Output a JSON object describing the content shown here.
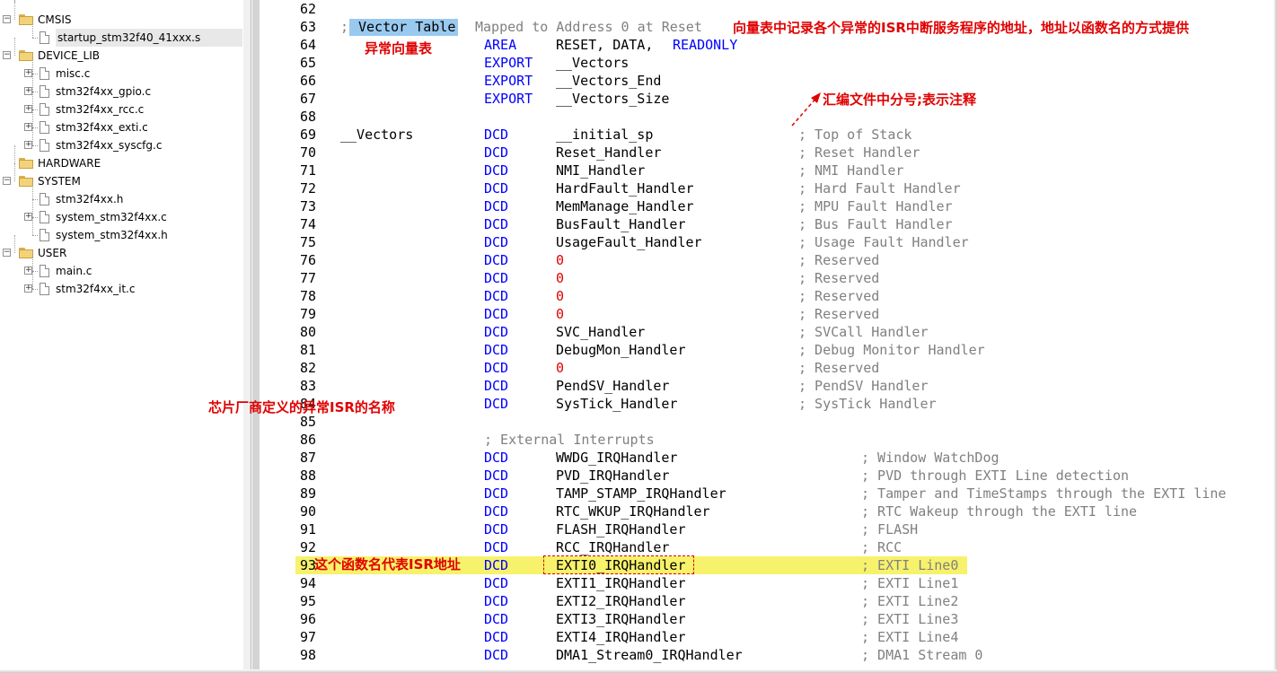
{
  "tree": {
    "nodes": [
      {
        "label": "CMSIS",
        "kind": "folder",
        "state": "-"
      },
      {
        "label": "startup_stm32f40_41xxx.s",
        "kind": "file",
        "state": "",
        "selected": true
      },
      {
        "label": "DEVICE_LIB",
        "kind": "folder",
        "state": "-"
      },
      {
        "label": "misc.c",
        "kind": "file",
        "state": "+"
      },
      {
        "label": "stm32f4xx_gpio.c",
        "kind": "file",
        "state": "+"
      },
      {
        "label": "stm32f4xx_rcc.c",
        "kind": "file",
        "state": "+"
      },
      {
        "label": "stm32f4xx_exti.c",
        "kind": "file",
        "state": "+"
      },
      {
        "label": "stm32f4xx_syscfg.c",
        "kind": "file",
        "state": "+"
      },
      {
        "label": "HARDWARE",
        "kind": "folder",
        "state": ""
      },
      {
        "label": "SYSTEM",
        "kind": "folder",
        "state": "-"
      },
      {
        "label": "stm32f4xx.h",
        "kind": "file",
        "state": ""
      },
      {
        "label": "system_stm32f4xx.c",
        "kind": "file",
        "state": "+"
      },
      {
        "label": "system_stm32f4xx.h",
        "kind": "file",
        "state": ""
      },
      {
        "label": "USER",
        "kind": "folder",
        "state": "-"
      },
      {
        "label": "main.c",
        "kind": "file",
        "state": "+"
      },
      {
        "label": "stm32f4xx_it.c",
        "kind": "file",
        "state": "+"
      }
    ]
  },
  "code": {
    "lines": [
      {
        "n": "62",
        "tokens": []
      },
      {
        "n": "63",
        "tokens": [
          {
            "c": 1,
            "t": "; ",
            "k": "cmt"
          },
          {
            "c": 3,
            "t": "Vector Table",
            "k": "plain"
          },
          {
            "c": 16,
            "t": "Mapped to Address 0 at Reset",
            "k": "cmt"
          }
        ]
      },
      {
        "n": "64",
        "tokens": [
          {
            "c": 17,
            "t": "AREA",
            "k": "kw"
          },
          {
            "c": 25,
            "t": "RESET, DATA, ",
            "k": "plain"
          },
          {
            "c": 38,
            "t": "READONLY",
            "k": "kw"
          }
        ]
      },
      {
        "n": "65",
        "tokens": [
          {
            "c": 17,
            "t": "EXPORT",
            "k": "kw"
          },
          {
            "c": 25,
            "t": "__Vectors",
            "k": "plain"
          }
        ]
      },
      {
        "n": "66",
        "tokens": [
          {
            "c": 17,
            "t": "EXPORT",
            "k": "kw"
          },
          {
            "c": 25,
            "t": "__Vectors_End",
            "k": "plain"
          }
        ]
      },
      {
        "n": "67",
        "tokens": [
          {
            "c": 17,
            "t": "EXPORT",
            "k": "kw"
          },
          {
            "c": 25,
            "t": "__Vectors_Size",
            "k": "plain"
          }
        ]
      },
      {
        "n": "68",
        "tokens": []
      },
      {
        "n": "69",
        "tokens": [
          {
            "c": 1,
            "t": "__Vectors",
            "k": "plain"
          },
          {
            "c": 17,
            "t": "DCD",
            "k": "kw"
          },
          {
            "c": 25,
            "t": "__initial_sp",
            "k": "plain"
          },
          {
            "c": 52,
            "t": "; Top of Stack",
            "k": "cmt"
          }
        ]
      },
      {
        "n": "70",
        "tokens": [
          {
            "c": 17,
            "t": "DCD",
            "k": "kw"
          },
          {
            "c": 25,
            "t": "Reset_Handler",
            "k": "plain"
          },
          {
            "c": 52,
            "t": "; Reset Handler",
            "k": "cmt"
          }
        ]
      },
      {
        "n": "71",
        "tokens": [
          {
            "c": 17,
            "t": "DCD",
            "k": "kw"
          },
          {
            "c": 25,
            "t": "NMI_Handler",
            "k": "plain"
          },
          {
            "c": 52,
            "t": "; NMI Handler",
            "k": "cmt"
          }
        ]
      },
      {
        "n": "72",
        "tokens": [
          {
            "c": 17,
            "t": "DCD",
            "k": "kw"
          },
          {
            "c": 25,
            "t": "HardFault_Handler",
            "k": "plain"
          },
          {
            "c": 52,
            "t": "; Hard Fault Handler",
            "k": "cmt"
          }
        ]
      },
      {
        "n": "73",
        "tokens": [
          {
            "c": 17,
            "t": "DCD",
            "k": "kw"
          },
          {
            "c": 25,
            "t": "MemManage_Handler",
            "k": "plain"
          },
          {
            "c": 52,
            "t": "; MPU Fault Handler",
            "k": "cmt"
          }
        ]
      },
      {
        "n": "74",
        "tokens": [
          {
            "c": 17,
            "t": "DCD",
            "k": "kw"
          },
          {
            "c": 25,
            "t": "BusFault_Handler",
            "k": "plain"
          },
          {
            "c": 52,
            "t": "; Bus Fault Handler",
            "k": "cmt"
          }
        ]
      },
      {
        "n": "75",
        "tokens": [
          {
            "c": 17,
            "t": "DCD",
            "k": "kw"
          },
          {
            "c": 25,
            "t": "UsageFault_Handler",
            "k": "plain"
          },
          {
            "c": 52,
            "t": "; Usage Fault Handler",
            "k": "cmt"
          }
        ]
      },
      {
        "n": "76",
        "tokens": [
          {
            "c": 17,
            "t": "DCD",
            "k": "kw"
          },
          {
            "c": 25,
            "t": "0",
            "k": "num"
          },
          {
            "c": 52,
            "t": "; Reserved",
            "k": "cmt"
          }
        ]
      },
      {
        "n": "77",
        "tokens": [
          {
            "c": 17,
            "t": "DCD",
            "k": "kw"
          },
          {
            "c": 25,
            "t": "0",
            "k": "num"
          },
          {
            "c": 52,
            "t": "; Reserved",
            "k": "cmt"
          }
        ]
      },
      {
        "n": "78",
        "tokens": [
          {
            "c": 17,
            "t": "DCD",
            "k": "kw"
          },
          {
            "c": 25,
            "t": "0",
            "k": "num"
          },
          {
            "c": 52,
            "t": "; Reserved",
            "k": "cmt"
          }
        ]
      },
      {
        "n": "79",
        "tokens": [
          {
            "c": 17,
            "t": "DCD",
            "k": "kw"
          },
          {
            "c": 25,
            "t": "0",
            "k": "num"
          },
          {
            "c": 52,
            "t": "; Reserved",
            "k": "cmt"
          }
        ]
      },
      {
        "n": "80",
        "tokens": [
          {
            "c": 17,
            "t": "DCD",
            "k": "kw"
          },
          {
            "c": 25,
            "t": "SVC_Handler",
            "k": "plain"
          },
          {
            "c": 52,
            "t": "; SVCall Handler",
            "k": "cmt"
          }
        ]
      },
      {
        "n": "81",
        "tokens": [
          {
            "c": 17,
            "t": "DCD",
            "k": "kw"
          },
          {
            "c": 25,
            "t": "DebugMon_Handler",
            "k": "plain"
          },
          {
            "c": 52,
            "t": "; Debug Monitor Handler",
            "k": "cmt"
          }
        ]
      },
      {
        "n": "82",
        "tokens": [
          {
            "c": 17,
            "t": "DCD",
            "k": "kw"
          },
          {
            "c": 25,
            "t": "0",
            "k": "num"
          },
          {
            "c": 52,
            "t": "; Reserved",
            "k": "cmt"
          }
        ]
      },
      {
        "n": "83",
        "tokens": [
          {
            "c": 17,
            "t": "DCD",
            "k": "kw"
          },
          {
            "c": 25,
            "t": "PendSV_Handler",
            "k": "plain"
          },
          {
            "c": 52,
            "t": "; PendSV Handler",
            "k": "cmt"
          }
        ]
      },
      {
        "n": "84",
        "tokens": [
          {
            "c": 17,
            "t": "DCD",
            "k": "kw"
          },
          {
            "c": 25,
            "t": "SysTick_Handler",
            "k": "plain"
          },
          {
            "c": 52,
            "t": "; SysTick Handler",
            "k": "cmt"
          }
        ]
      },
      {
        "n": "85",
        "tokens": []
      },
      {
        "n": "86",
        "tokens": [
          {
            "c": 17,
            "t": "; External Interrupts",
            "k": "cmt"
          }
        ]
      },
      {
        "n": "87",
        "tokens": [
          {
            "c": 17,
            "t": "DCD",
            "k": "kw"
          },
          {
            "c": 25,
            "t": "WWDG_IRQHandler",
            "k": "plain"
          },
          {
            "c": 59,
            "t": "; Window WatchDog",
            "k": "cmt"
          }
        ]
      },
      {
        "n": "88",
        "tokens": [
          {
            "c": 17,
            "t": "DCD",
            "k": "kw"
          },
          {
            "c": 25,
            "t": "PVD_IRQHandler",
            "k": "plain"
          },
          {
            "c": 59,
            "t": "; PVD through EXTI Line detection",
            "k": "cmt"
          }
        ]
      },
      {
        "n": "89",
        "tokens": [
          {
            "c": 17,
            "t": "DCD",
            "k": "kw"
          },
          {
            "c": 25,
            "t": "TAMP_STAMP_IRQHandler",
            "k": "plain"
          },
          {
            "c": 59,
            "t": "; Tamper and TimeStamps through the EXTI line",
            "k": "cmt"
          }
        ]
      },
      {
        "n": "90",
        "tokens": [
          {
            "c": 17,
            "t": "DCD",
            "k": "kw"
          },
          {
            "c": 25,
            "t": "RTC_WKUP_IRQHandler",
            "k": "plain"
          },
          {
            "c": 59,
            "t": "; RTC Wakeup through the EXTI line",
            "k": "cmt"
          }
        ]
      },
      {
        "n": "91",
        "tokens": [
          {
            "c": 17,
            "t": "DCD",
            "k": "kw"
          },
          {
            "c": 25,
            "t": "FLASH_IRQHandler",
            "k": "plain"
          },
          {
            "c": 59,
            "t": "; FLASH",
            "k": "cmt"
          }
        ]
      },
      {
        "n": "92",
        "tokens": [
          {
            "c": 17,
            "t": "DCD",
            "k": "kw"
          },
          {
            "c": 25,
            "t": "RCC_IRQHandler",
            "k": "plain"
          },
          {
            "c": 59,
            "t": "; RCC",
            "k": "cmt"
          }
        ]
      },
      {
        "n": "93",
        "tokens": [
          {
            "c": 17,
            "t": "DCD",
            "k": "kw"
          },
          {
            "c": 25,
            "t": "EXTI0_IRQHandler",
            "k": "plain"
          },
          {
            "c": 59,
            "t": "; EXTI Line0",
            "k": "cmt"
          }
        ]
      },
      {
        "n": "94",
        "tokens": [
          {
            "c": 17,
            "t": "DCD",
            "k": "kw"
          },
          {
            "c": 25,
            "t": "EXTI1_IRQHandler",
            "k": "plain"
          },
          {
            "c": 59,
            "t": "; EXTI Line1",
            "k": "cmt"
          }
        ]
      },
      {
        "n": "95",
        "tokens": [
          {
            "c": 17,
            "t": "DCD",
            "k": "kw"
          },
          {
            "c": 25,
            "t": "EXTI2_IRQHandler",
            "k": "plain"
          },
          {
            "c": 59,
            "t": "; EXTI Line2",
            "k": "cmt"
          }
        ]
      },
      {
        "n": "96",
        "tokens": [
          {
            "c": 17,
            "t": "DCD",
            "k": "kw"
          },
          {
            "c": 25,
            "t": "EXTI3_IRQHandler",
            "k": "plain"
          },
          {
            "c": 59,
            "t": "; EXTI Line3",
            "k": "cmt"
          }
        ]
      },
      {
        "n": "97",
        "tokens": [
          {
            "c": 17,
            "t": "DCD",
            "k": "kw"
          },
          {
            "c": 25,
            "t": "EXTI4_IRQHandler",
            "k": "plain"
          },
          {
            "c": 59,
            "t": "; EXTI Line4",
            "k": "cmt"
          }
        ]
      },
      {
        "n": "98",
        "tokens": [
          {
            "c": 17,
            "t": "DCD",
            "k": "kw"
          },
          {
            "c": 25,
            "t": "DMA1_Stream0_IRQHandler",
            "k": "plain"
          },
          {
            "c": 59,
            "t": "; DMA1 Stream 0",
            "k": "cmt"
          }
        ]
      }
    ]
  },
  "annotations": {
    "vector_table_desc": "向量表中记录各个异常的ISR中断服务程序的地址，地址以函数名的方式提供",
    "vector_table_label": "异常向量表",
    "semicolon_comment": "汇编文件中分号;表示注释",
    "vendor_isr_names": "芯片厂商定义的异常ISR的名称",
    "func_name_isr_addr": "这个函数名代表ISR地址"
  },
  "colors": {
    "keyword": "#0000ff",
    "number": "#e00000",
    "comment": "#808080",
    "annotation": "#e00000",
    "line_highlight": "#f7f26b",
    "selection": "#99c9ef"
  }
}
